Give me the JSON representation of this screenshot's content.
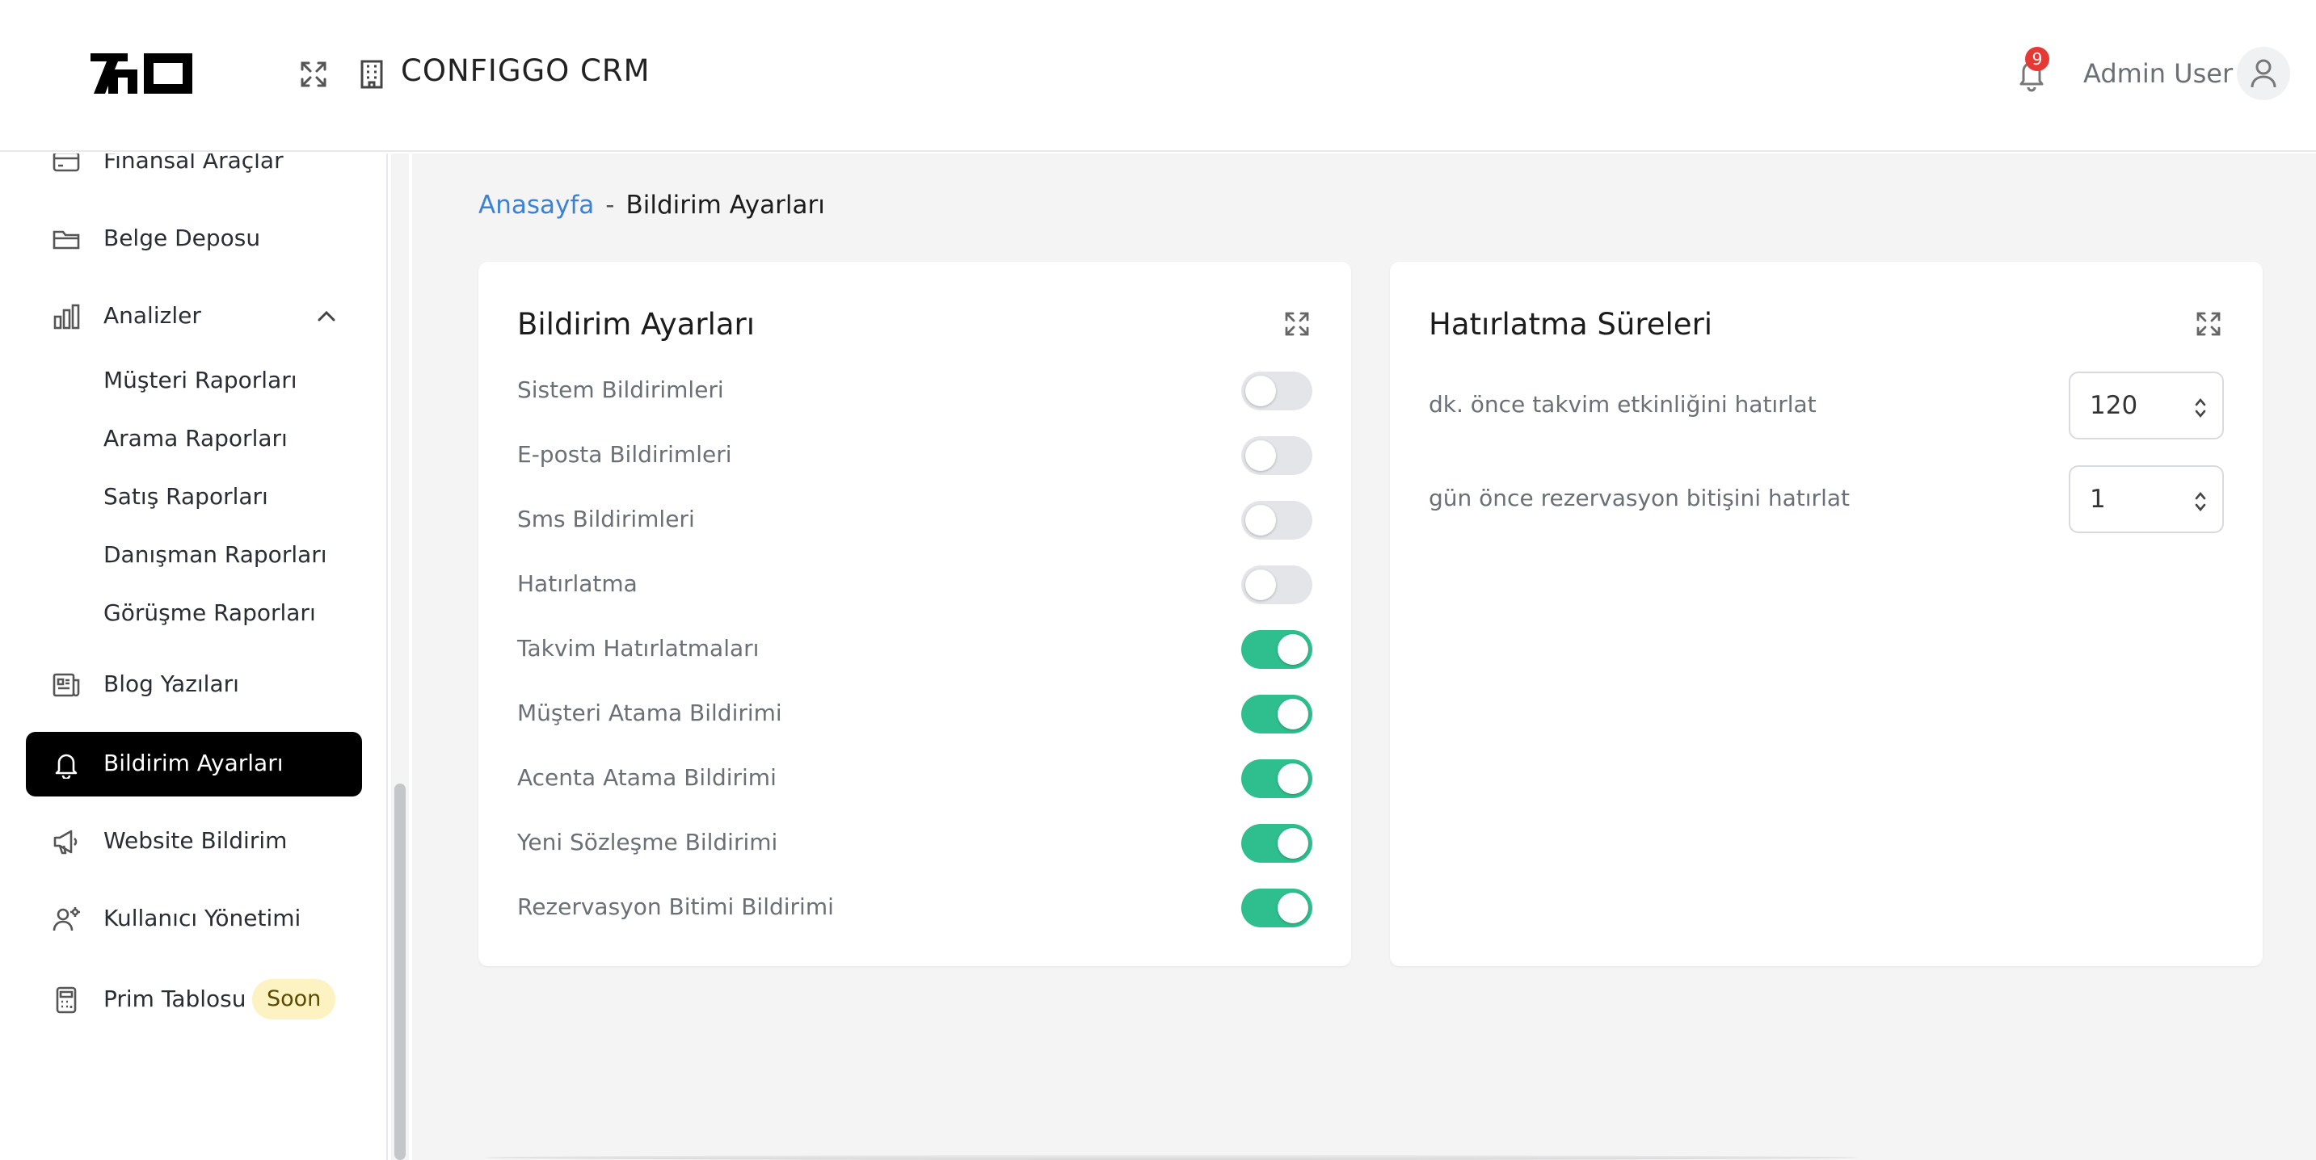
{
  "header": {
    "app_title": "CONFIGGO  CRM",
    "notification_count": "9",
    "user_name": "Admin User"
  },
  "sidebar": {
    "items": [
      {
        "label": "Finansal Araçlar",
        "icon": "credit-card-icon"
      },
      {
        "label": "Belge Deposu",
        "icon": "folder-icon"
      },
      {
        "label": "Analizler",
        "icon": "bar-chart-icon",
        "expanded": true,
        "subitems": [
          "Müşteri Raporları",
          "Arama Raporları",
          "Satış Raporları",
          "Danışman Raporları",
          "Görüşme Raporları"
        ]
      },
      {
        "label": "Blog Yazıları",
        "icon": "newspaper-icon"
      },
      {
        "label": "Bildirim Ayarları",
        "icon": "bell-icon",
        "active": true
      },
      {
        "label": "Website Bildirim",
        "icon": "megaphone-icon"
      },
      {
        "label": "Kullanıcı Yönetimi",
        "icon": "users-cog-icon"
      },
      {
        "label": "Prim Tablosu",
        "icon": "calculator-icon",
        "badge": "Soon"
      }
    ]
  },
  "breadcrumb": {
    "home": "Anasayfa",
    "separator": "-",
    "current": "Bildirim Ayarları"
  },
  "notification_settings": {
    "title": "Bildirim Ayarları",
    "toggles": [
      {
        "label": "Sistem Bildirimleri",
        "on": false
      },
      {
        "label": "E-posta Bildirimleri",
        "on": false
      },
      {
        "label": "Sms Bildirimleri",
        "on": false
      },
      {
        "label": "Hatırlatma",
        "on": false
      },
      {
        "label": "Takvim Hatırlatmaları",
        "on": true
      },
      {
        "label": "Müşteri Atama Bildirimi",
        "on": true
      },
      {
        "label": "Acenta Atama Bildirimi",
        "on": true
      },
      {
        "label": "Yeni Sözleşme Bildirimi",
        "on": true
      },
      {
        "label": "Rezervasyon Bitimi Bildirimi",
        "on": true
      }
    ]
  },
  "reminder_durations": {
    "title": "Hatırlatma Süreleri",
    "fields": [
      {
        "label": "dk. önce takvim etkinliğini hatırlat",
        "value": "120"
      },
      {
        "label": "gün önce rezervasyon bitişini hatırlat",
        "value": "1"
      }
    ]
  },
  "colors": {
    "accent_on": "#2fbf8f",
    "active_nav": "#000000",
    "link": "#3b82d6",
    "badge": "#e53935",
    "soon_badge": "#fdf3c2"
  }
}
